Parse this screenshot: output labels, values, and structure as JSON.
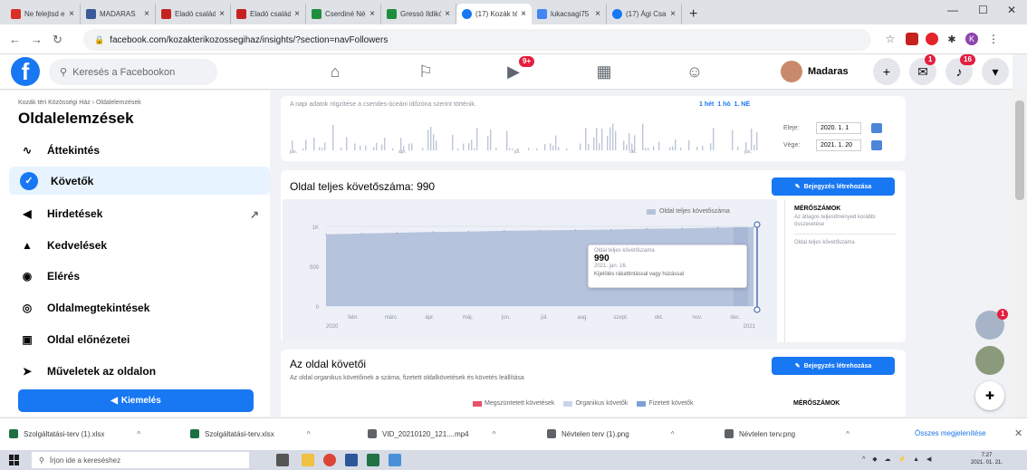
{
  "browser": {
    "tabs": [
      {
        "title": "Ne felejtsd el",
        "color": "#d93025",
        "active": false
      },
      {
        "title": "MADARAS",
        "color": "#3b5998",
        "active": false
      },
      {
        "title": "Eladó családi",
        "color": "#c5221f",
        "active": false
      },
      {
        "title": "Eladó családi",
        "color": "#c5221f",
        "active": false
      },
      {
        "title": "Cserdiné Né",
        "color": "#1e8e3e",
        "active": false
      },
      {
        "title": "Gressó Ildikó",
        "color": "#1e8e3e",
        "active": false
      },
      {
        "title": "(17) Kozák té",
        "color": "#1877f2",
        "active": true
      },
      {
        "title": "lukacsagi75",
        "color": "#4285f4",
        "active": false
      },
      {
        "title": "(17) Ági Csa",
        "color": "#1877f2",
        "active": false
      }
    ],
    "url": "facebook.com/kozakterikozossegihaz/insights/?section=navFollowers",
    "profile_initial": "K"
  },
  "fb": {
    "search_placeholder": "Keresés a Facebookon",
    "video_badge": "9+",
    "profile_name": "Madaras",
    "messenger_badge": "1",
    "notif_badge": "16"
  },
  "sidebar": {
    "breadcrumb": "Kozák téri Közösségi Ház › Oldalelemzések",
    "title": "Oldalelemzések",
    "items": [
      {
        "label": "Áttekintés",
        "icon": "overview-icon"
      },
      {
        "label": "Követők",
        "icon": "followers-icon"
      },
      {
        "label": "Hirdetések",
        "icon": "megaphone-icon"
      },
      {
        "label": "Kedvelések",
        "icon": "like-icon"
      },
      {
        "label": "Elérés",
        "icon": "reach-icon"
      },
      {
        "label": "Oldalmegtekintések",
        "icon": "eye-icon"
      },
      {
        "label": "Oldal előnézetei",
        "icon": "preview-icon"
      },
      {
        "label": "Műveletek az oldalon",
        "icon": "cursor-icon"
      }
    ],
    "promote_label": "Kiemelés"
  },
  "range": {
    "note": "A napi adatok rögzítése a csendes-óceáni időzóna szerint történik.",
    "btn_week": "1 hét",
    "btn_month": "1 hó",
    "btn_ne": "1. NÉ",
    "start_label": "Eleje:",
    "start_value": "2020. 1. 1",
    "end_label": "Vége:",
    "end_value": "2021. 1. 20",
    "months": [
      "jan.",
      "ápr.",
      "júl.",
      "okt.",
      "jan."
    ]
  },
  "followers": {
    "title": "Oldal teljes követőszáma: 990",
    "post_button": "Bejegyzés létrehozása",
    "legend": "Oldal teljes követőszáma",
    "y_ticks": [
      "1K",
      "500",
      "0"
    ],
    "x_ticks": [
      "febr.",
      "márc.",
      "ápr.",
      "máj.",
      "jún.",
      "júl.",
      "aug.",
      "szept.",
      "okt.",
      "nov.",
      "dec."
    ],
    "x_year_start": "2020",
    "x_year_end": "2021",
    "tooltip": {
      "label": "Oldal teljes követőszáma",
      "value": "990",
      "date": "2021. jan. 16.",
      "hint": "Kijelölés rákattintással vagy húzással"
    },
    "metrics_title": "MÉRŐSZÁMOK",
    "metrics_sub": "Az átlagos teljesítményed korábbi összevetése",
    "metrics_row": "Oldal teljes követőszáma"
  },
  "page_followers": {
    "title": "Az oldal követői",
    "subtitle": "Az oldal organikus követőinek a száma, fizetett oldalkövetések és követés leállítása",
    "post_button": "Bejegyzés létrehozása",
    "legend": [
      "Megszüntetett követések",
      "Organikus követők",
      "Fizetett követők"
    ],
    "legend_colors": [
      "#e9516a",
      "#c7d4ec",
      "#7f9fd9"
    ],
    "metrics_title": "MÉRŐSZÁMOK"
  },
  "downloads": {
    "items": [
      "Szolgáltatási-terv (1).xlsx",
      "Szolgáltatási-terv.xlsx",
      "VID_20210120_121....mp4",
      "Névtelen terv (1).png",
      "Névtelen terv.png"
    ],
    "show_all": "Összes megjelenítése"
  },
  "taskbar": {
    "search_placeholder": "Írjon ide a kereséshez",
    "time": "7:27",
    "date": "2021. 01. 21."
  },
  "chart_data": {
    "type": "area",
    "title": "Oldal teljes követőszáma: 990",
    "series": [
      {
        "name": "Oldal teljes követőszáma",
        "values": [
          900,
          910,
          920,
          930,
          935,
          945,
          950,
          955,
          960,
          970,
          975,
          985,
          990
        ]
      }
    ],
    "x": [
      "jan.",
      "febr.",
      "márc.",
      "ápr.",
      "máj.",
      "jún.",
      "júl.",
      "aug.",
      "szept.",
      "okt.",
      "nov.",
      "dec.",
      "jan."
    ],
    "ylim": [
      0,
      1000
    ],
    "grid": true,
    "legend": "top-right",
    "color": "#b6c3dd"
  }
}
